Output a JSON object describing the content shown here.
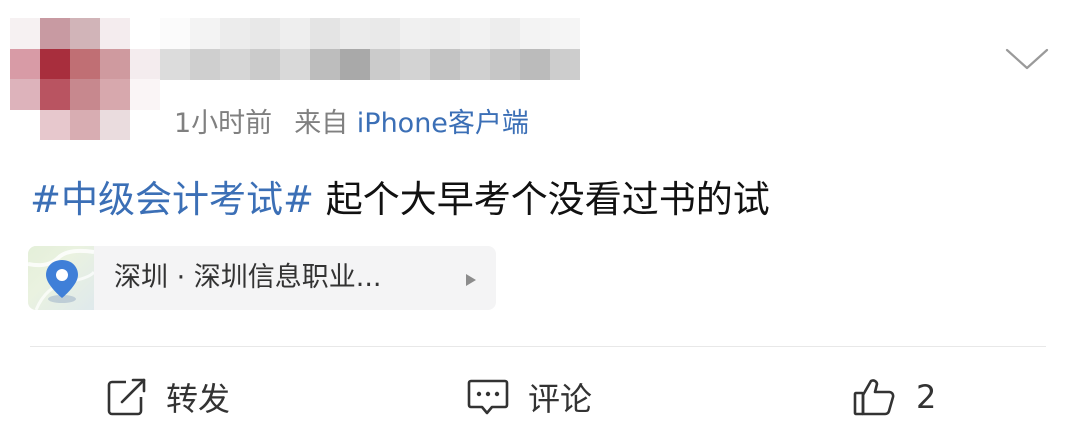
{
  "post": {
    "avatar": {
      "pixelated": true
    },
    "username": {
      "pixelated": true
    },
    "time": "1小时前",
    "source_prefix": "来自",
    "source_client": "iPhone客户端",
    "topic": "#中级会计考试#",
    "text": "起个大早考个没看过书的试",
    "location": "深圳 · 深圳信息职业...",
    "menu_icon": "chevron-down-icon"
  },
  "actions": {
    "repost": {
      "icon": "repost-icon",
      "label": "转发"
    },
    "comment": {
      "icon": "comment-icon",
      "label": "评论"
    },
    "like": {
      "icon": "thumbs-up-icon",
      "count": "2"
    }
  },
  "colors": {
    "link": "#3b6fb6",
    "meta": "#808080",
    "text": "#111111",
    "location_bg": "#f4f4f5"
  }
}
